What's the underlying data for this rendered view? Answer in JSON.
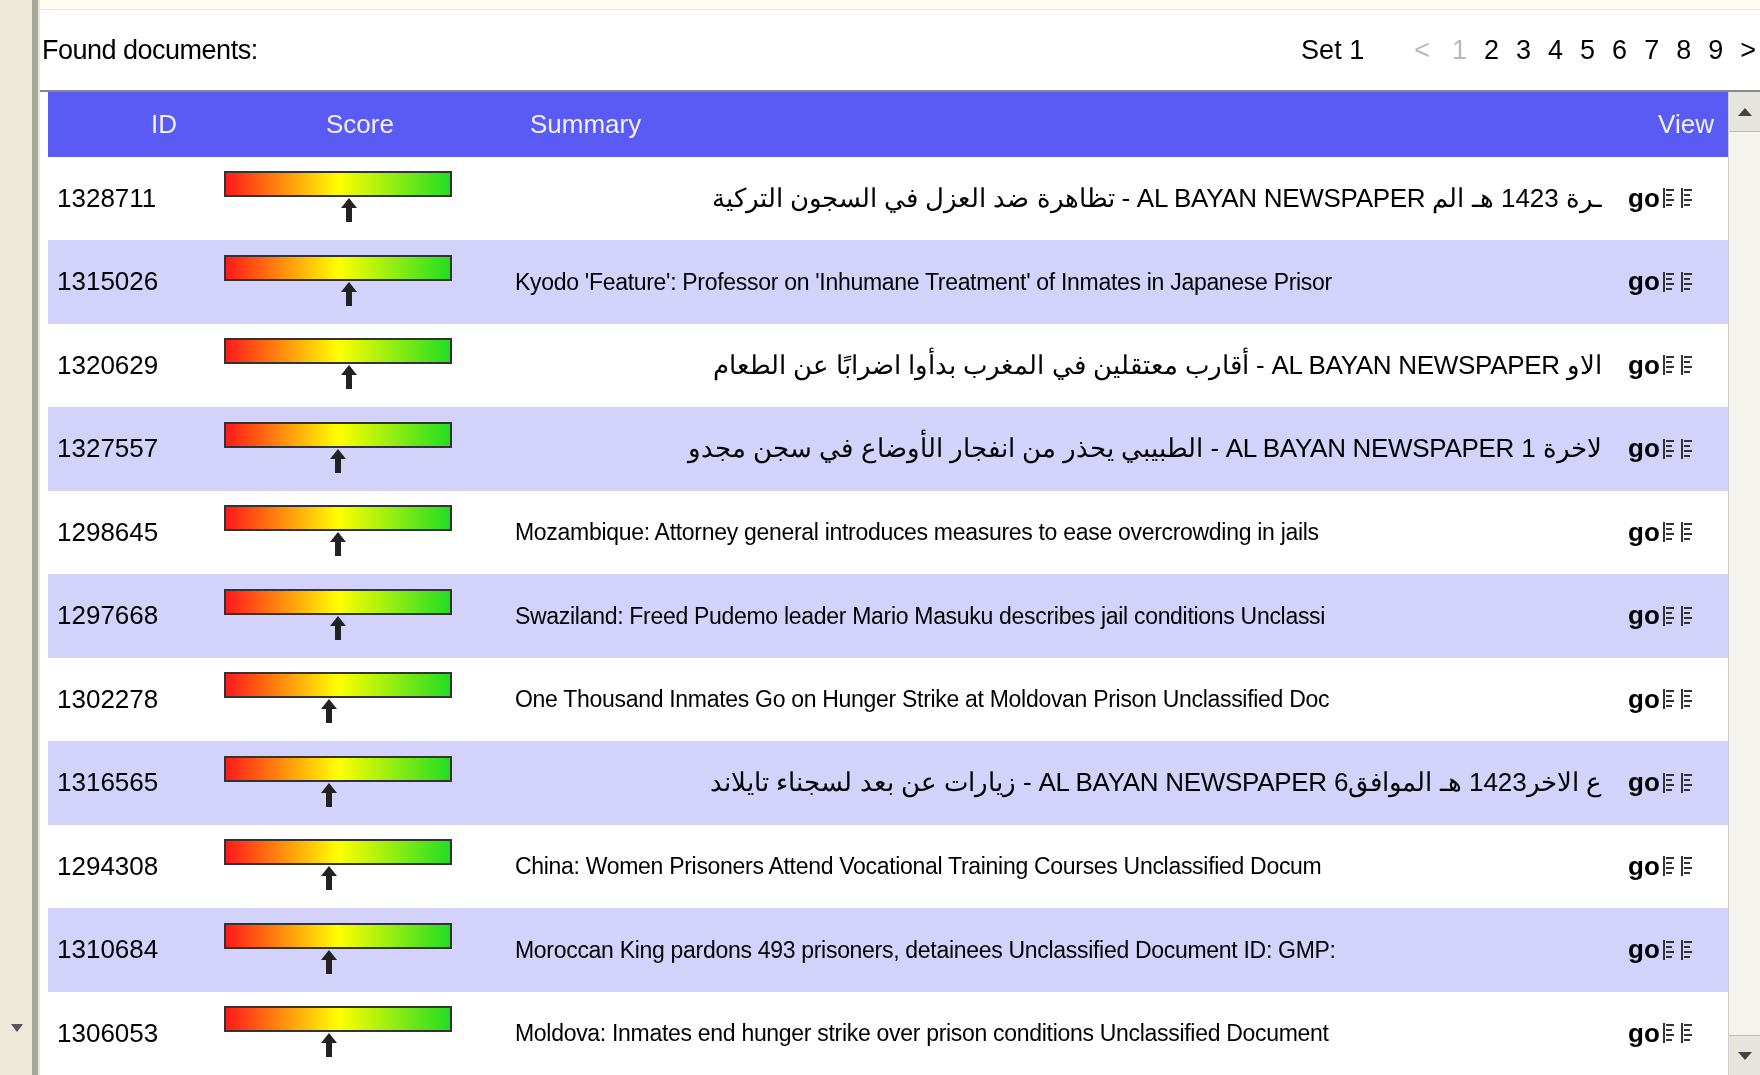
{
  "heading": "Found documents:",
  "pager": {
    "set_label": "Set 1",
    "prev": {
      "label": "<",
      "disabled": true
    },
    "pages": [
      {
        "label": "1",
        "selected": true
      },
      {
        "label": "2",
        "selected": false
      },
      {
        "label": "3",
        "selected": false
      },
      {
        "label": "4",
        "selected": false
      },
      {
        "label": "5",
        "selected": false
      },
      {
        "label": "6",
        "selected": false
      },
      {
        "label": "7",
        "selected": false
      },
      {
        "label": "8",
        "selected": false
      },
      {
        "label": "9",
        "selected": false
      }
    ],
    "next": {
      "label": ">",
      "disabled": false
    }
  },
  "table": {
    "columns": [
      "ID",
      "Score",
      "Summary",
      "View"
    ],
    "rows": [
      {
        "id": "1328711",
        "level": 0.55,
        "summary": "ـرة 1423 هـ الم AL BAYAN NEWSPAPER - تظاهرة ضد العزل في السجون التركية",
        "rtl": true,
        "view": "go"
      },
      {
        "id": "1315026",
        "level": 0.55,
        "summary": "Kyodo 'Feature': Professor on 'Inhumane Treatment' of Inmates in Japanese Prisor",
        "rtl": false,
        "view": "go"
      },
      {
        "id": "1320629",
        "level": 0.55,
        "summary": "الاو AL BAYAN NEWSPAPER - أقارب معتقلين في المغرب بدأوا اضرابًا عن الطعام",
        "rtl": true,
        "view": "go"
      },
      {
        "id": "1327557",
        "level": 0.5,
        "summary": "لاخرة 1 AL BAYAN NEWSPAPER - الطبيبي يحذر من انفجار الأوضاع في سجن مجدو",
        "rtl": true,
        "view": "go"
      },
      {
        "id": "1298645",
        "level": 0.5,
        "summary": "Mozambique: Attorney general introduces measures to ease overcrowding in jails",
        "rtl": false,
        "view": "go"
      },
      {
        "id": "1297668",
        "level": 0.5,
        "summary": "Swaziland: Freed Pudemo leader Mario Masuku describes jail conditions Unclassi",
        "rtl": false,
        "view": "go"
      },
      {
        "id": "1302278",
        "level": 0.46,
        "summary": "One Thousand Inmates Go on Hunger Strike at Moldovan Prison Unclassified Doc",
        "rtl": false,
        "view": "go"
      },
      {
        "id": "1316565",
        "level": 0.46,
        "summary": "ع الاخر1423 هـ الموافق6 AL BAYAN NEWSPAPER - زيارات عن بعد لسجناء تايلاند",
        "rtl": true,
        "view": "go"
      },
      {
        "id": "1294308",
        "level": 0.46,
        "summary": "China: Women Prisoners Attend Vocational Training Courses Unclassified Docum",
        "rtl": false,
        "view": "go"
      },
      {
        "id": "1310684",
        "level": 0.46,
        "summary": "Moroccan King pardons 493 prisoners, detainees Unclassified Document ID: GMP:",
        "rtl": false,
        "view": "go"
      },
      {
        "id": "1306053",
        "level": 0.46,
        "summary": "Moldova: Inmates end hunger strike over prison conditions Unclassified Document",
        "rtl": false,
        "view": "go"
      }
    ]
  }
}
